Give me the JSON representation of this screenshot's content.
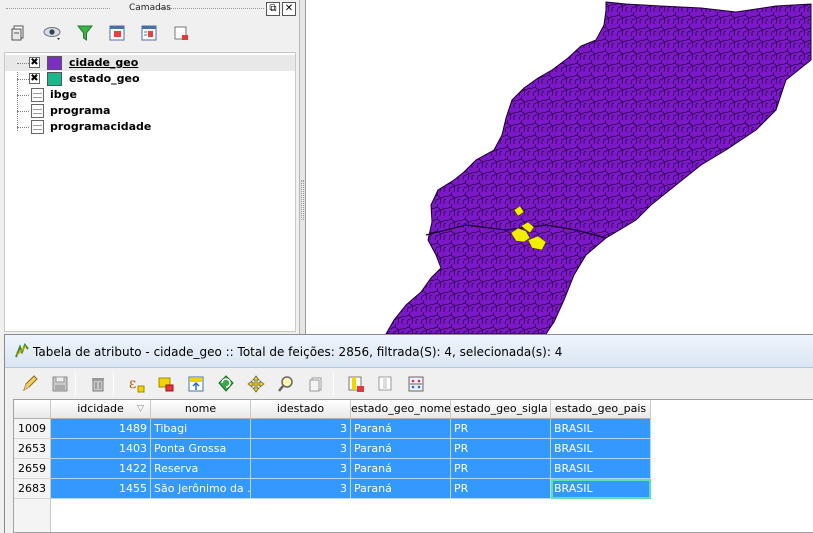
{
  "layers_panel": {
    "title": "Camadas",
    "float_button_icon": "float-icon",
    "close_button_icon": "close-icon",
    "toolbar": [
      {
        "name": "add-group-icon"
      },
      {
        "name": "eye-visibility-icon"
      },
      {
        "name": "filter-icon"
      },
      {
        "name": "expand-all-icon"
      },
      {
        "name": "collapse-all-icon"
      },
      {
        "name": "remove-layer-icon"
      }
    ],
    "layers": [
      {
        "label": "cidade_geo",
        "checked": "✖",
        "color": "#7b2fbe",
        "kind": "vector"
      },
      {
        "label": "estado_geo",
        "checked": "✖",
        "color": "#1fb58c",
        "kind": "vector"
      },
      {
        "label": "ibge",
        "kind": "table"
      },
      {
        "label": "programa",
        "kind": "table"
      },
      {
        "label": "programacidade",
        "kind": "table"
      }
    ]
  },
  "map": {
    "fill_color": "#7b18c8",
    "border_color": "#1a0028",
    "highlight_color": "#f2ee00"
  },
  "attribute_table": {
    "title": "Tabela de atributo - cidade_geo :: Total de feições: 2856, filtrada(S): 4, selecionada(s): 4",
    "toolbar": [
      "pencil-edit-icon",
      "save-icon",
      "delete-icon",
      "expression-icon",
      "select-icon",
      "move-top-icon",
      "invert-selection-icon",
      "pan-to-icon",
      "zoom-to-icon",
      "copy-icon",
      "delete-column-icon",
      "add-column-icon",
      "field-calculator-icon"
    ],
    "columns": [
      "idcidade",
      "nome",
      "idestado",
      "estado_geo_nome",
      "estado_geo_sigla",
      "estado_geo_pais"
    ],
    "rows": [
      {
        "id": "1009",
        "cells": [
          "1489",
          "Tibagi",
          "3",
          "Paraná",
          "PR",
          "BRASIL"
        ]
      },
      {
        "id": "2653",
        "cells": [
          "1403",
          "Ponta Grossa",
          "3",
          "Paraná",
          "PR",
          "BRASIL"
        ]
      },
      {
        "id": "2659",
        "cells": [
          "1422",
          "Reserva",
          "3",
          "Paraná",
          "PR",
          "BRASIL"
        ]
      },
      {
        "id": "2683",
        "cells": [
          "1455",
          "São Jerônimo da ...",
          "3",
          "Paraná",
          "PR",
          "BRASIL"
        ]
      }
    ],
    "selection_color": "#3399ff"
  }
}
